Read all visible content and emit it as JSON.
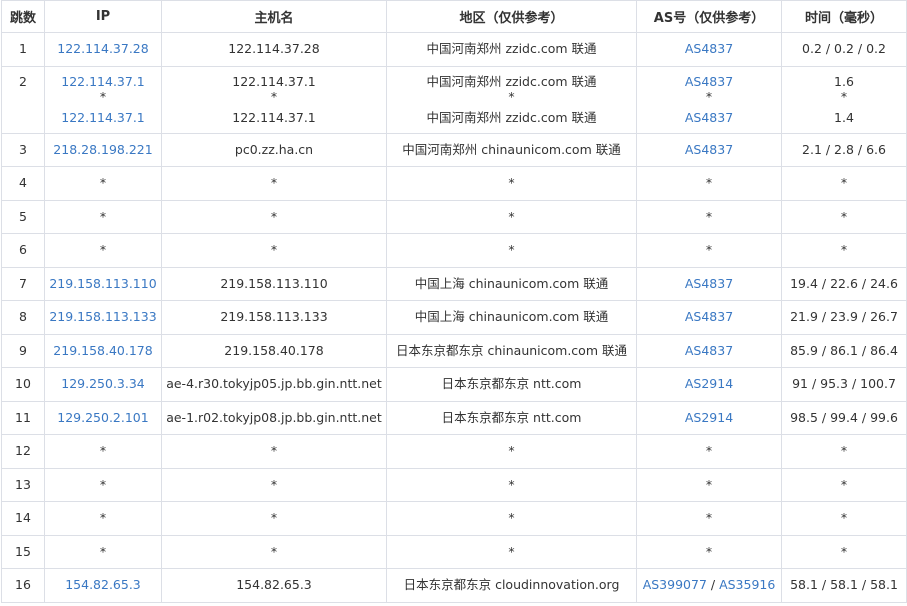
{
  "headers": {
    "hop": "跳数",
    "ip": "IP",
    "hostname": "主机名",
    "region": "地区（仅供参考）",
    "as": "AS号（仅供参考）",
    "time": "时间（毫秒）"
  },
  "rows": [
    {
      "hop": "1",
      "ip": "122.114.37.28",
      "hostname": "122.114.37.28",
      "region": "中国河南郑州 zzidc.com 联通",
      "as": "AS4837",
      "time": "0.2 / 0.2 / 0.2"
    },
    {
      "hop": "2",
      "ip": "122.114.37.1",
      "ip2": "122.114.37.1",
      "hostname": "122.114.37.1",
      "hostname2": "122.114.37.1",
      "region": "中国河南郑州 zzidc.com 联通",
      "region2": "中国河南郑州 zzidc.com 联通",
      "as": "AS4837",
      "as2": "AS4837",
      "time": "1.6",
      "time2": "1.4",
      "mid": "*"
    },
    {
      "hop": "3",
      "ip": "218.28.198.221",
      "hostname": "pc0.zz.ha.cn",
      "region": "中国河南郑州 chinaunicom.com 联通",
      "as": "AS4837",
      "time": "2.1 / 2.8 / 6.6"
    },
    {
      "hop": "4",
      "ip": "*",
      "hostname": "*",
      "region": "*",
      "as": "*",
      "time": "*"
    },
    {
      "hop": "5",
      "ip": "*",
      "hostname": "*",
      "region": "*",
      "as": "*",
      "time": "*"
    },
    {
      "hop": "6",
      "ip": "*",
      "hostname": "*",
      "region": "*",
      "as": "*",
      "time": "*"
    },
    {
      "hop": "7",
      "ip": "219.158.113.110",
      "hostname": "219.158.113.110",
      "region": "中国上海 chinaunicom.com 联通",
      "as": "AS4837",
      "time": "19.4 / 22.6 / 24.6"
    },
    {
      "hop": "8",
      "ip": "219.158.113.133",
      "hostname": "219.158.113.133",
      "region": "中国上海 chinaunicom.com 联通",
      "as": "AS4837",
      "time": "21.9 / 23.9 / 26.7"
    },
    {
      "hop": "9",
      "ip": "219.158.40.178",
      "hostname": "219.158.40.178",
      "region": "日本东京都东京 chinaunicom.com 联通",
      "as": "AS4837",
      "time": "85.9 / 86.1 / 86.4"
    },
    {
      "hop": "10",
      "ip": "129.250.3.34",
      "hostname": "ae-4.r30.tokyjp05.jp.bb.gin.ntt.net",
      "region": "日本东京都东京 ntt.com",
      "as": "AS2914",
      "time": "91 / 95.3 / 100.7"
    },
    {
      "hop": "11",
      "ip": "129.250.2.101",
      "hostname": "ae-1.r02.tokyjp08.jp.bb.gin.ntt.net",
      "region": "日本东京都东京 ntt.com",
      "as": "AS2914",
      "time": "98.5 / 99.4 / 99.6"
    },
    {
      "hop": "12",
      "ip": "*",
      "hostname": "*",
      "region": "*",
      "as": "*",
      "time": "*"
    },
    {
      "hop": "13",
      "ip": "*",
      "hostname": "*",
      "region": "*",
      "as": "*",
      "time": "*"
    },
    {
      "hop": "14",
      "ip": "*",
      "hostname": "*",
      "region": "*",
      "as": "*",
      "time": "*"
    },
    {
      "hop": "15",
      "ip": "*",
      "hostname": "*",
      "region": "*",
      "as": "*",
      "time": "*"
    },
    {
      "hop": "16",
      "ip": "154.82.65.3",
      "hostname": "154.82.65.3",
      "region": "日本东京都东京 cloudinnovation.org",
      "as": "AS399077",
      "as_sep": " / ",
      "as2": "AS35916",
      "time": "58.1 / 58.1 / 58.1"
    }
  ],
  "colors": {
    "link": "#3a78c3",
    "border": "#dcdfe6",
    "text": "#333333"
  }
}
